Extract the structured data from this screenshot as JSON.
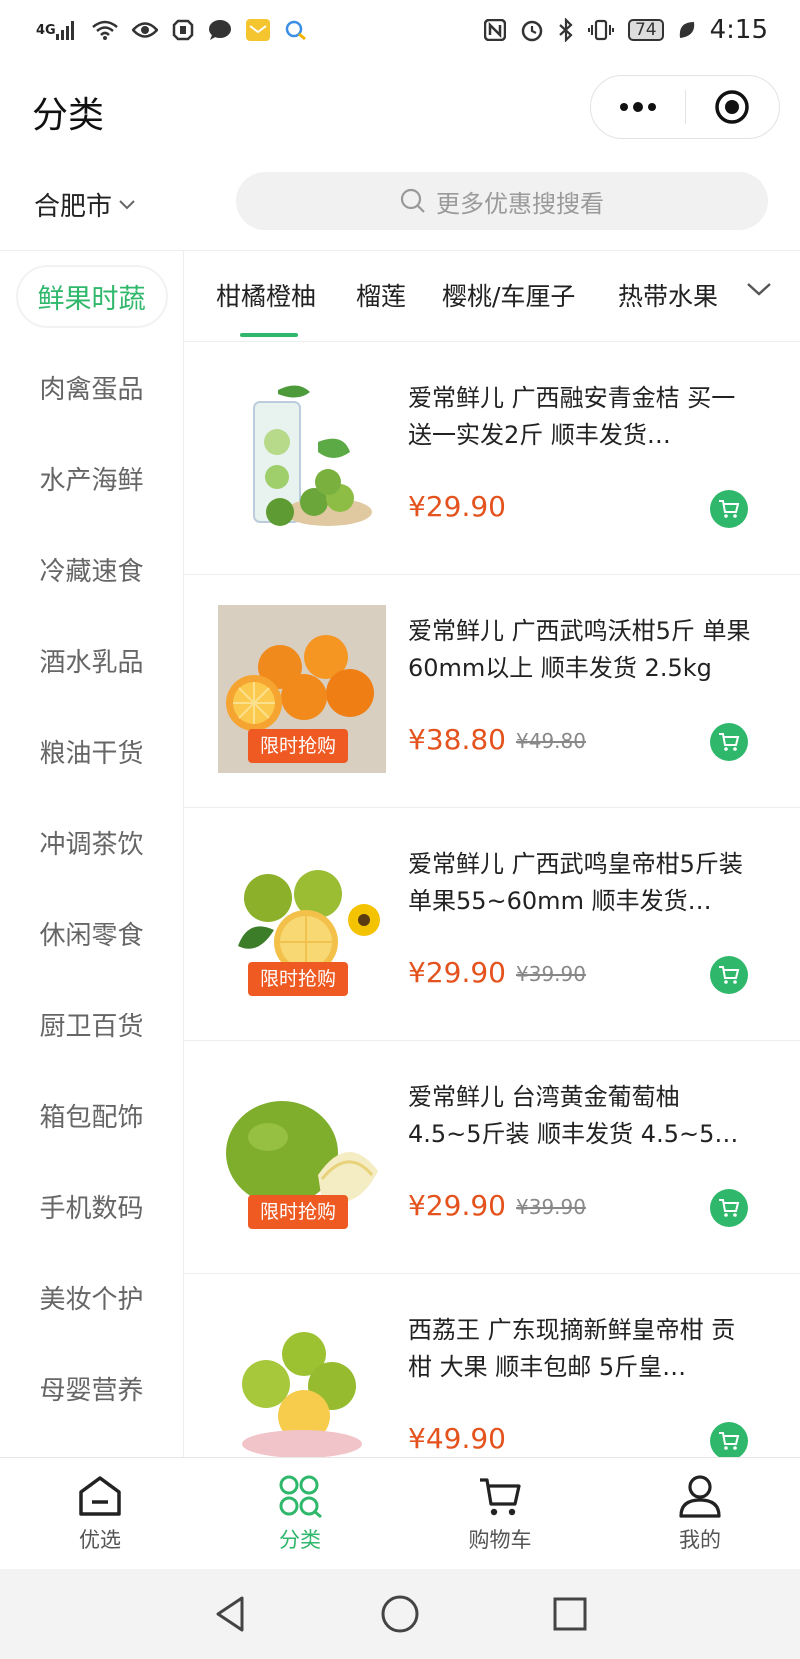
{
  "status_bar": {
    "network": "4G",
    "battery": "74",
    "time": "4:15"
  },
  "header": {
    "title": "分类",
    "more_icon": "more-dots-icon",
    "close_icon": "target-circle-icon"
  },
  "search_row": {
    "city": "合肥市",
    "placeholder": "更多优惠搜搜看"
  },
  "sidebar": {
    "items": [
      {
        "label": "鲜果时蔬",
        "active": true
      },
      {
        "label": "肉禽蛋品"
      },
      {
        "label": "水产海鲜"
      },
      {
        "label": "冷藏速食"
      },
      {
        "label": "酒水乳品"
      },
      {
        "label": "粮油干货"
      },
      {
        "label": "冲调茶饮"
      },
      {
        "label": "休闲零食"
      },
      {
        "label": "厨卫百货"
      },
      {
        "label": "箱包配饰"
      },
      {
        "label": "手机数码"
      },
      {
        "label": "美妆个护"
      },
      {
        "label": "母婴营养"
      }
    ]
  },
  "sub_tabs": {
    "items": [
      {
        "label": "柑橘橙柚",
        "active": true
      },
      {
        "label": "榴莲"
      },
      {
        "label": "樱桃/车厘子"
      },
      {
        "label": "热带水果"
      }
    ]
  },
  "products": [
    {
      "title": "爱常鲜儿 广西融安青金桔 买一送一实发2斤 顺丰发货…",
      "price": "¥29.90",
      "original_price": "",
      "badge": ""
    },
    {
      "title": "爱常鲜儿 广西武鸣沃柑5斤 单果60mm以上 顺丰发货 2.5kg",
      "price": "¥38.80",
      "original_price": "¥49.80",
      "badge": "限时抢购"
    },
    {
      "title": "爱常鲜儿 广西武鸣皇帝柑5斤装 单果55~60mm 顺丰发货…",
      "price": "¥29.90",
      "original_price": "¥39.90",
      "badge": "限时抢购"
    },
    {
      "title": "爱常鲜儿 台湾黄金葡萄柚 4.5~5斤装 顺丰发货 4.5~5…",
      "price": "¥29.90",
      "original_price": "¥39.90",
      "badge": "限时抢购"
    },
    {
      "title": "西荔王 广东现摘新鲜皇帝柑 贡柑 大果 顺丰包邮 5斤皇…",
      "price": "¥49.90",
      "original_price": "",
      "badge": ""
    }
  ],
  "tabbar": {
    "items": [
      {
        "label": "优选",
        "icon": "home-icon"
      },
      {
        "label": "分类",
        "icon": "category-icon",
        "active": true
      },
      {
        "label": "购物车",
        "icon": "cart-icon"
      },
      {
        "label": "我的",
        "icon": "user-icon"
      }
    ]
  },
  "colors": {
    "accent": "#2fb86b",
    "price": "#e4521d",
    "badge": "#ee5a22"
  }
}
